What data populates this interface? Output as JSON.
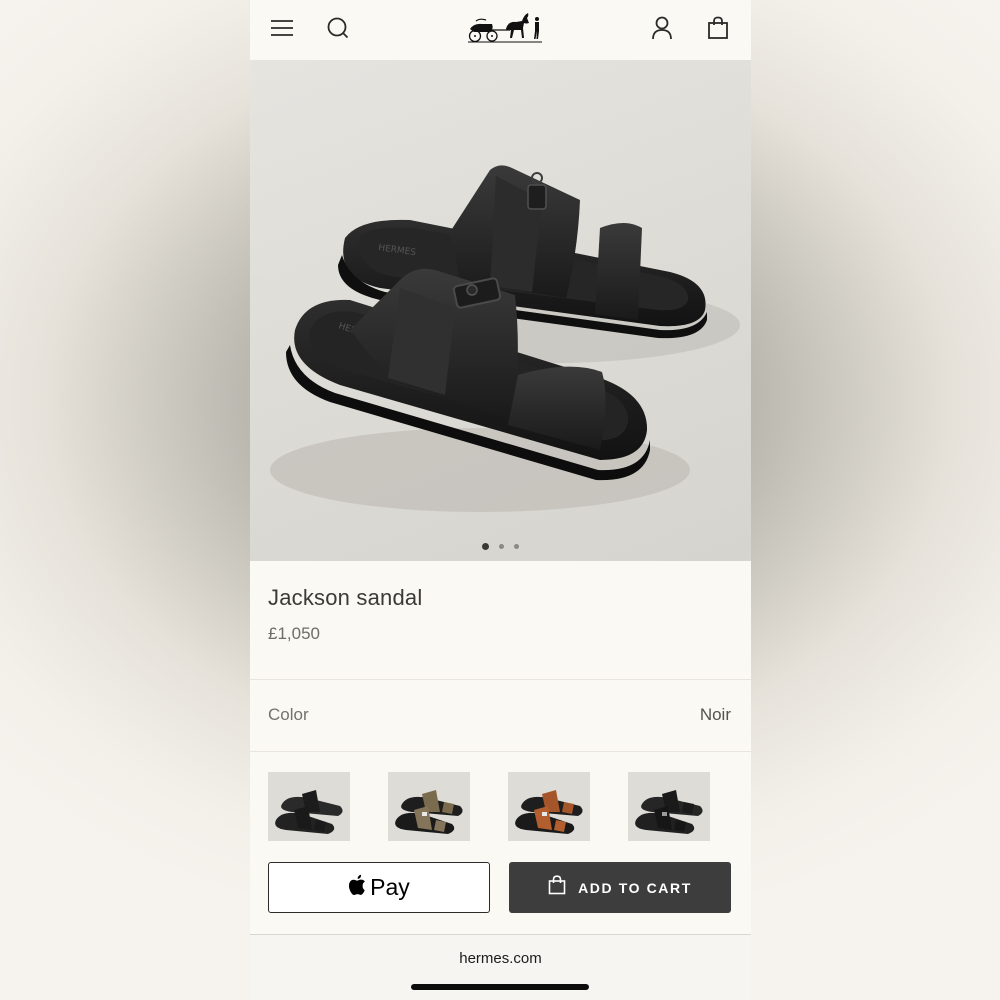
{
  "header": {
    "menu_icon": "hamburger-menu-icon",
    "search_icon": "search-icon",
    "logo": "hermes-carriage-logo",
    "account_icon": "user-icon",
    "bag_icon": "shopping-bag-icon"
  },
  "gallery": {
    "image": "black leather Jackson sandals with Kelly buckle",
    "pages": 3,
    "current_page": 1
  },
  "product": {
    "title": "Jackson sandal",
    "price": "£1,050"
  },
  "color": {
    "label": "Color",
    "value": "Noir",
    "swatches": [
      {
        "name": "Noir",
        "tone": "#2a2a2a"
      },
      {
        "name": "Khaki",
        "tone": "#7a6a4e"
      },
      {
        "name": "Fauve",
        "tone": "#a4552a"
      },
      {
        "name": "Black",
        "tone": "#1f1f1f"
      }
    ]
  },
  "actions": {
    "apple_pay_label": "Pay",
    "add_to_cart_label": "ADD TO CART"
  },
  "browser": {
    "url": "hermes.com"
  },
  "colors": {
    "page_bg": "#fbf9f4",
    "button_dark": "#3d3d3d",
    "text_primary": "#3b3a37"
  }
}
